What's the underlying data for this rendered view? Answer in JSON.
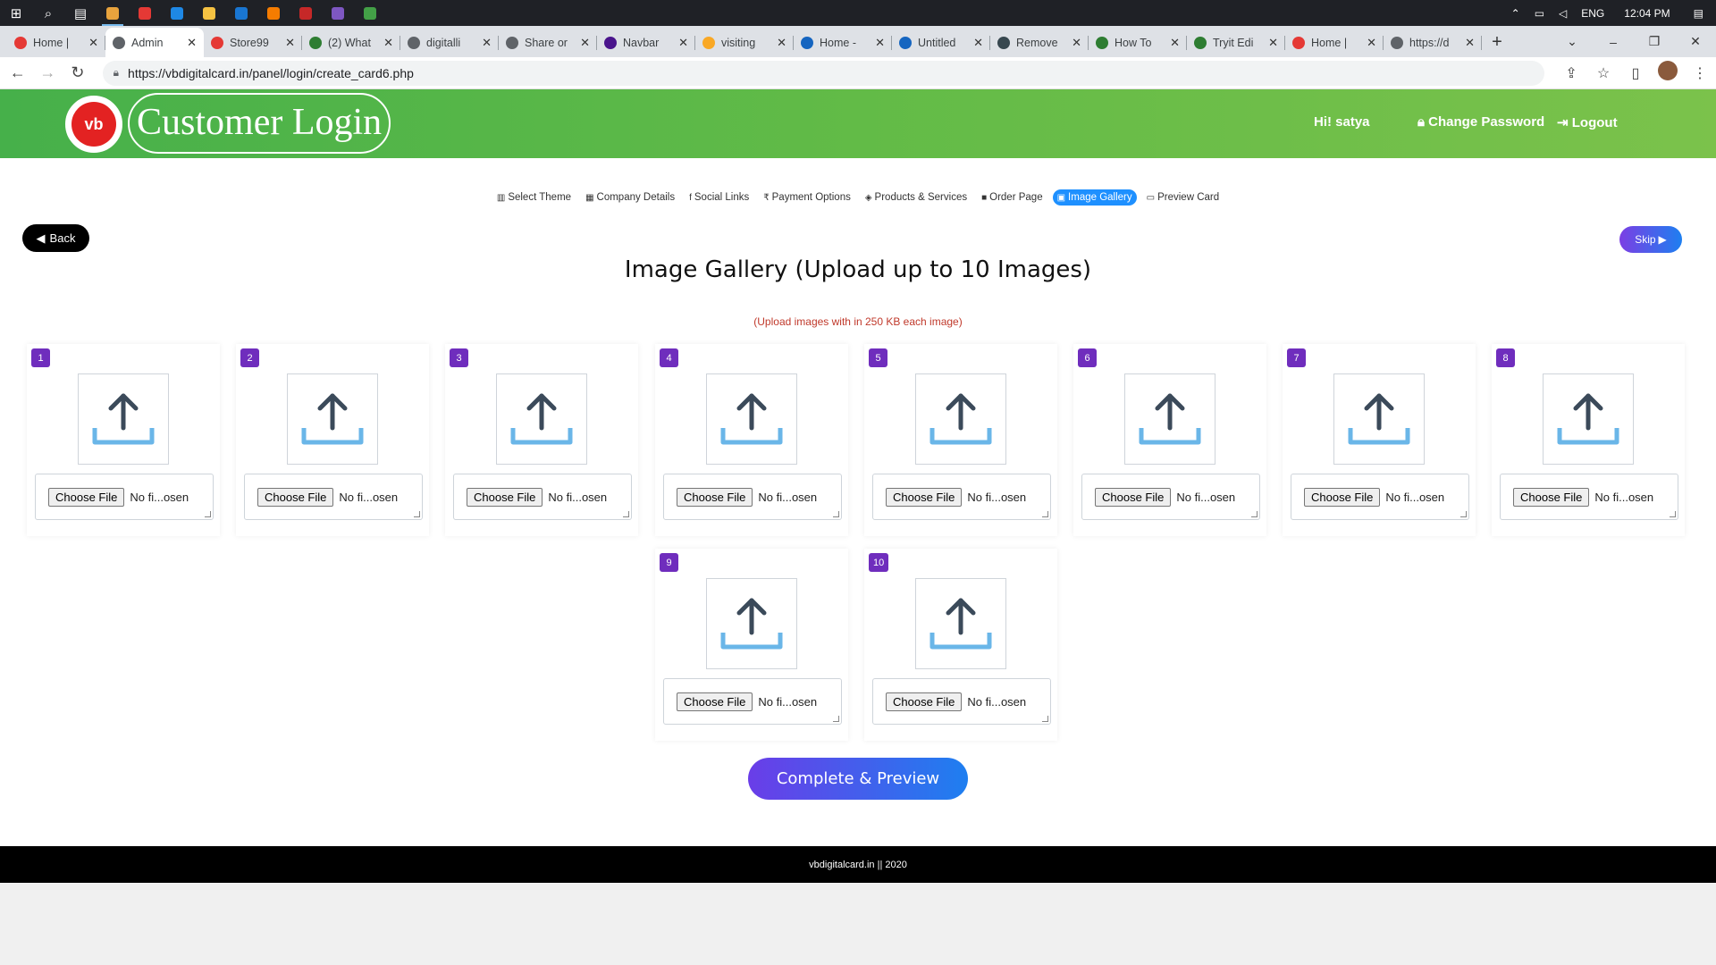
{
  "taskbar": {
    "apps": [
      {
        "name": "chrome-icon",
        "color": "#e8a33d",
        "active": true
      },
      {
        "name": "youtube-icon",
        "color": "#e53935",
        "active": false
      },
      {
        "name": "skype-icon",
        "color": "#1e88e5",
        "active": false
      },
      {
        "name": "file-explorer-icon",
        "color": "#f5c242",
        "active": false
      },
      {
        "name": "mail-icon",
        "color": "#1976d2",
        "active": false
      },
      {
        "name": "sublime-icon",
        "color": "#f57c00",
        "active": false
      },
      {
        "name": "flag-icon",
        "color": "#c62828",
        "active": false
      },
      {
        "name": "github-icon",
        "color": "#7e57c2",
        "active": false
      },
      {
        "name": "chrome-alt-icon",
        "color": "#43a047",
        "active": false
      }
    ],
    "language": "ENG",
    "time": "12:04 PM"
  },
  "browser": {
    "tabs": [
      {
        "title": "Home | ",
        "color": "#e53935",
        "active": false
      },
      {
        "title": "Admin",
        "color": "#5f6368",
        "active": true
      },
      {
        "title": "Store99",
        "color": "#e53935",
        "active": false
      },
      {
        "title": "(2) What",
        "color": "#2e7d32",
        "active": false
      },
      {
        "title": "digitalli",
        "color": "#5f6368",
        "active": false
      },
      {
        "title": "Share or",
        "color": "#5f6368",
        "active": false
      },
      {
        "title": "Navbar",
        "color": "#4a148c",
        "active": false
      },
      {
        "title": "visiting",
        "color": "#f9a825",
        "active": false
      },
      {
        "title": "Home -",
        "color": "#1565c0",
        "active": false
      },
      {
        "title": "Untitled",
        "color": "#1565c0",
        "active": false
      },
      {
        "title": "Remove",
        "color": "#37474f",
        "active": false
      },
      {
        "title": "How To",
        "color": "#2e7d32",
        "active": false
      },
      {
        "title": "Tryit Edi",
        "color": "#2e7d32",
        "active": false
      },
      {
        "title": "Home | ",
        "color": "#e53935",
        "active": false
      },
      {
        "title": "https://d",
        "color": "#5f6368",
        "active": false
      }
    ],
    "url": "https://vbdigitalcard.in/panel/login/create_card6.php"
  },
  "header": {
    "logo_text": "vb",
    "title": "Customer Login",
    "greeting": "Hi! satya",
    "change_password": "Change Password",
    "logout": "Logout"
  },
  "steps": [
    {
      "icon": "▥",
      "label": "Select Theme",
      "active": false
    },
    {
      "icon": "▦",
      "label": "Company Details",
      "active": false
    },
    {
      "icon": "f",
      "label": "Social Links",
      "active": false
    },
    {
      "icon": "₹",
      "label": "Payment Options",
      "active": false
    },
    {
      "icon": "◈",
      "label": "Products & Services",
      "active": false
    },
    {
      "icon": "■",
      "label": "Order Page",
      "active": false
    },
    {
      "icon": "▣",
      "label": "Image Gallery",
      "active": true
    },
    {
      "icon": "▭",
      "label": "Preview Card",
      "active": false
    }
  ],
  "buttons": {
    "back": "Back",
    "skip": "Skip",
    "complete": "Complete & Preview"
  },
  "gallery": {
    "title": "Image Gallery (Upload up to 10 Images)",
    "note": "(Upload images with in 250 KB each image)",
    "choose_label": "Choose File",
    "no_file_text": "No fi...osen",
    "slots": [
      "1",
      "2",
      "3",
      "4",
      "5",
      "6",
      "7",
      "8",
      "9",
      "10"
    ]
  },
  "colors": {
    "header_gradient_start": "#46b04a",
    "header_gradient_end": "#7bc24b",
    "active_step": "#1e90ff",
    "badge": "#6f2dbd",
    "upload_arrow": "#3b4a5a",
    "upload_tray": "#6ab6e8"
  },
  "footer": {
    "text": "vbdigitalcard.in || 2020"
  }
}
